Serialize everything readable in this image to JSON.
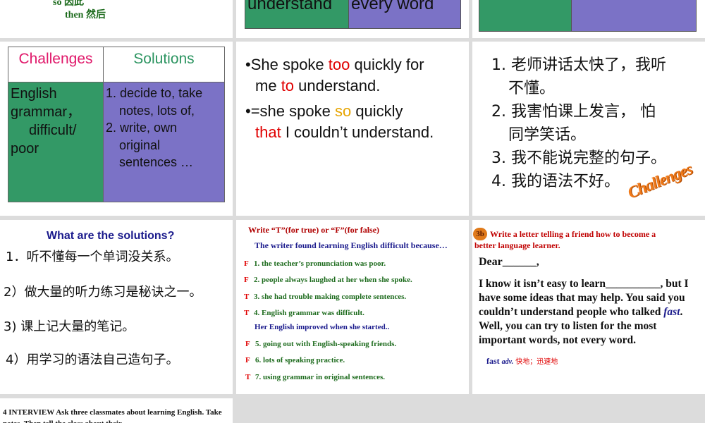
{
  "slide1": {
    "line1": "so 因此",
    "line2": "then 然后"
  },
  "slide2": {
    "cell1": "understand",
    "cell2": "every word"
  },
  "slide4": {
    "header_challenges": "Challenges",
    "header_solutions": "Solutions",
    "challenge_text": [
      "English",
      "grammar，",
      "difficult/",
      "poor"
    ],
    "solutions": [
      "1. decide to, take",
      "notes, lots of,",
      "2. write, own",
      "original",
      "sentences …"
    ]
  },
  "slide5": {
    "bullet1_a": "She spoke ",
    "bullet1_b": "too",
    "bullet1_c": " quickly for",
    "bullet1_d": "me ",
    "bullet1_e": "to",
    "bullet1_f": " understand.",
    "bullet2_a": "=she spoke ",
    "bullet2_b": "so",
    "bullet2_c": " quickly",
    "bullet2_d": "that",
    "bullet2_e": " I couldn’t understand."
  },
  "slide6": {
    "items": [
      "1. 老师讲话太快了，我听",
      "不懂。",
      "2. 我害怕课上发言，  怕",
      "同学笑话。",
      "3. 我不能说完整的句子。",
      "4. 我的语法不好。"
    ],
    "stamp": "Challenges"
  },
  "slide7": {
    "title": "What are the solutions?",
    "items": [
      "1．听不懂每一个单词没关系。",
      "2）做大量的听力练习是秘诀之一。",
      "3)    课上记大量的笔记。",
      "4）用学习的语法自己造句子。"
    ]
  },
  "slide8": {
    "instruction": "Write “T”(for true) or “F”(for false)",
    "intro1": "The writer found learning English difficult because…",
    "group1": [
      {
        "mark": "F",
        "text": "1. the teacher’s pronunciation was poor."
      },
      {
        "mark": "F",
        "text": "2. people always laughed at her when she spoke."
      },
      {
        "mark": "T",
        "text": "3. she had trouble making complete sentences."
      },
      {
        "mark": "T",
        "text": "4. English grammar was difficult."
      }
    ],
    "intro2": "Her English improved when she started..",
    "group2": [
      {
        "mark": "F",
        "text": "5. going out with English-speaking friends."
      },
      {
        "mark": "F",
        "text": "6. lots of speaking practice."
      },
      {
        "mark": "T",
        "text": "7. using grammar in original sentences."
      }
    ]
  },
  "slide9": {
    "badge": "3b",
    "task1": "Write a letter telling a friend how to become a",
    "task2": "better language learner.",
    "greeting": "Dear______,",
    "body_a": "I know it isn’t easy to learn__________, but I have some ideas that may help. You said you couldn’t understand people who talked ",
    "body_fast": "fast",
    "body_b": ". Well, you can try to listen for the most important words, not every word.",
    "vocab_word": "fast",
    "vocab_pos": "adv.",
    "vocab_cn": "快地；迅速地"
  },
  "slide10": {
    "text": "4   INTERVIEW        Ask three classmates about learning English. Take notes. Then tell the class about their"
  }
}
